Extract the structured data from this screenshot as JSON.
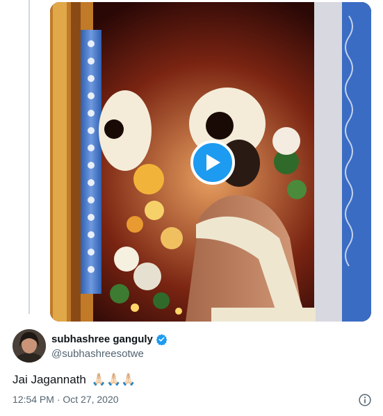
{
  "tweet": {
    "display_name": "subhashree ganguly",
    "handle": "@subhashreesotwe",
    "text": "Jai Jagannath",
    "emojis": "🙏🏻🙏🏻🙏🏻",
    "timestamp": "12:54 PM · Oct 27, 2020",
    "verified": true
  },
  "media": {
    "type": "video",
    "play_icon": "play-icon"
  },
  "icons": {
    "verified": "verified-badge-icon",
    "info": "info-icon"
  },
  "colors": {
    "accent": "#1d9bf0",
    "secondary_text": "#536471",
    "primary_text": "#0f1419"
  }
}
